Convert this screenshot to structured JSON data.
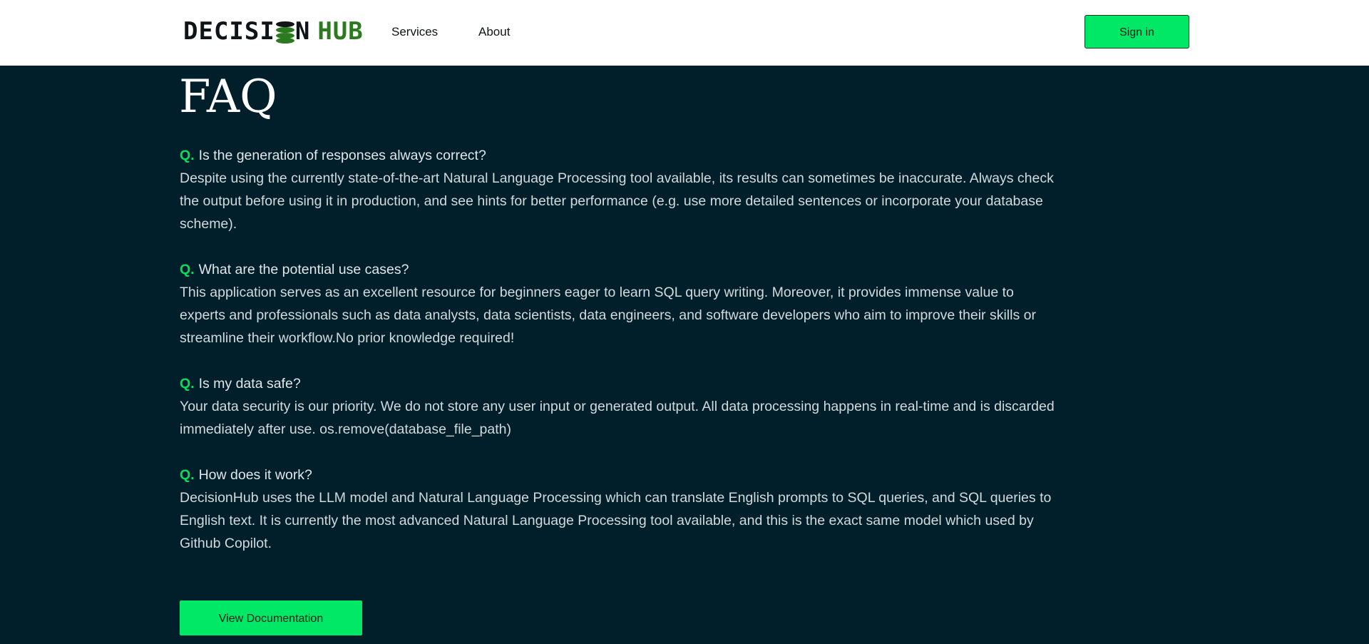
{
  "header": {
    "logo": {
      "text_left": "DECISI",
      "text_mid": "N",
      "text_right": "HUB",
      "icon": "database-stack-icon"
    },
    "nav": [
      {
        "label": "Services"
      },
      {
        "label": "About"
      }
    ],
    "signin_label": "Sign in"
  },
  "main": {
    "title": "FAQ",
    "q_marker": "Q.",
    "faqs": [
      {
        "question": "Is the generation of responses always correct?",
        "answer": "Despite using the currently state-of-the-art Natural Language Processing tool available, its results can sometimes be inaccurate. Always check the output before using it in production, and see hints for better performance (e.g. use more detailed sentences or incorporate your database scheme)."
      },
      {
        "question": "What are the potential use cases?",
        "answer": "This application serves as an excellent resource for beginners eager to learn SQL query writing. Moreover, it provides immense value to experts and professionals such as data analysts, data scientists, data engineers, and software developers who aim to improve their skills or streamline their workflow.No prior knowledge required!"
      },
      {
        "question": "Is my data safe?",
        "answer": "Your data security is our priority. We do not store any user input or generated output. All data processing happens in real-time and is discarded immediately after use. os.remove(database_file_path)"
      },
      {
        "question": "How does it work?",
        "answer": "DecisionHub uses the LLM model and Natural Language Processing which can translate English prompts to SQL queries, and SQL queries to English text. It is currently the most advanced Natural Language Processing tool available, and this is the exact same model which used by Github Copilot."
      }
    ],
    "doc_button_label": "View Documentation"
  },
  "colors": {
    "background": "#011f2b",
    "accent_green": "#00e865",
    "logo_green": "#2b7a1f",
    "header_bg": "#ffffff"
  }
}
